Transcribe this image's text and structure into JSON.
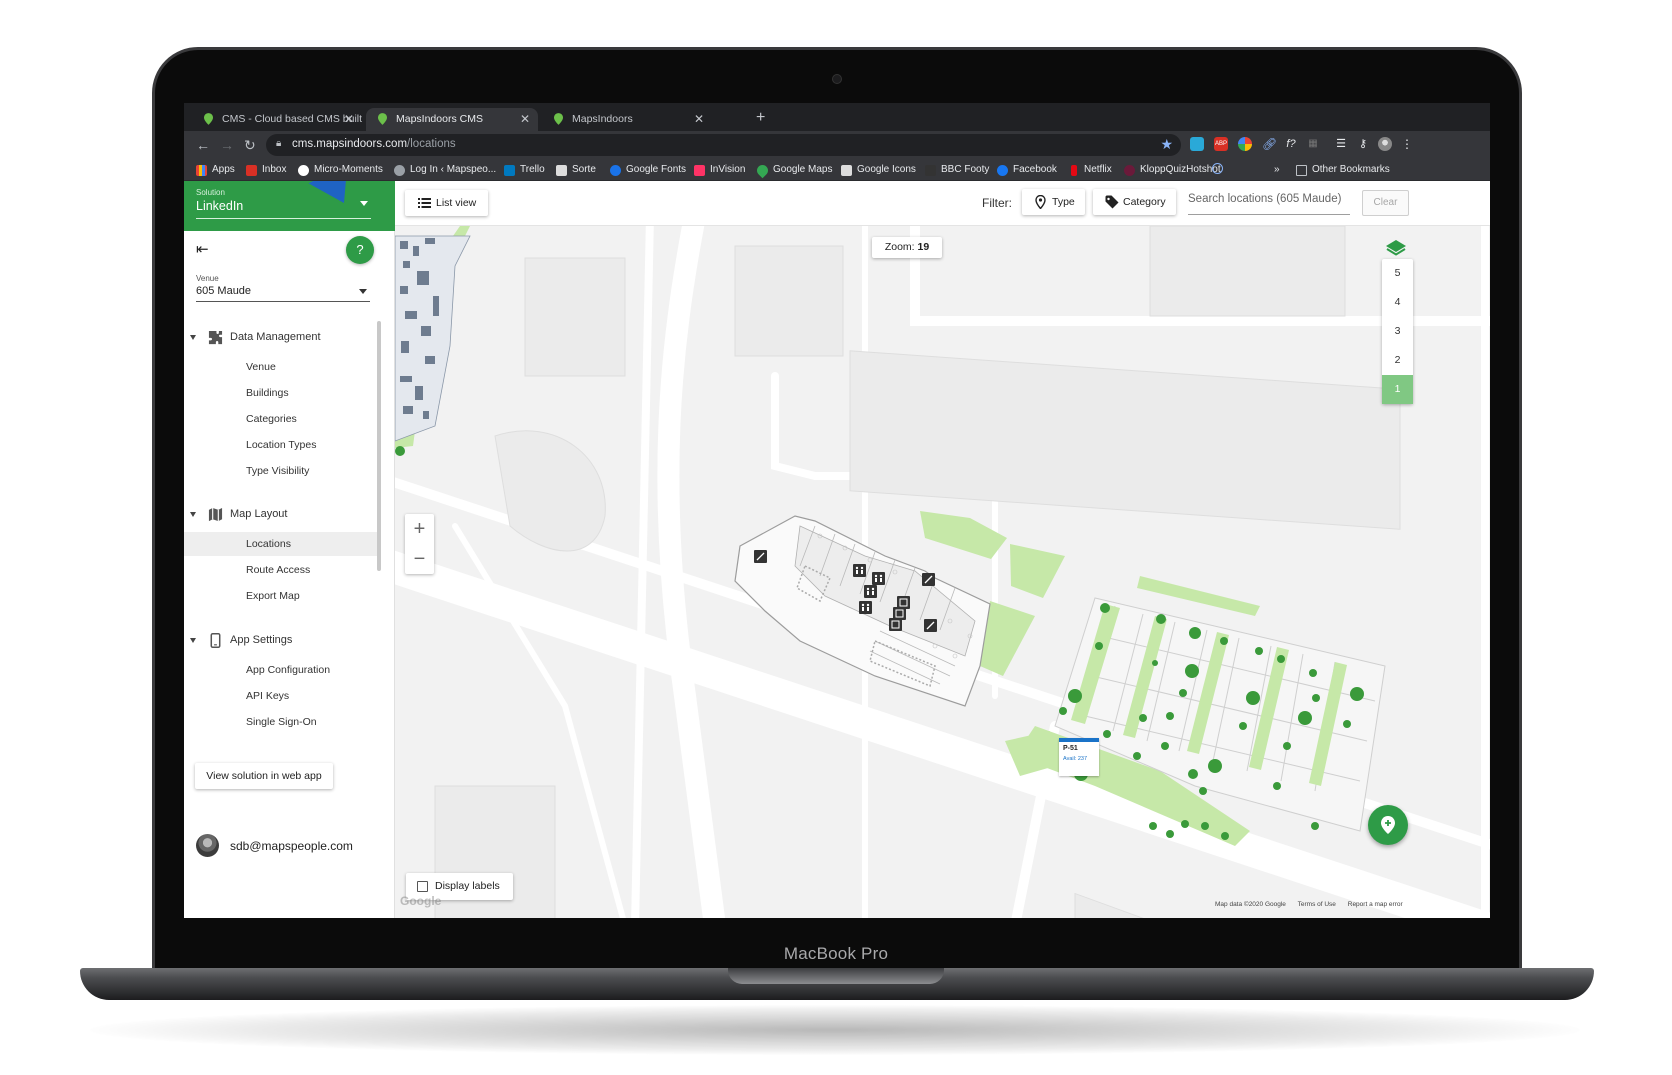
{
  "device": {
    "brand": "MacBook Pro"
  },
  "browser": {
    "tabs": [
      {
        "title": "CMS - Cloud based CMS built",
        "active": false
      },
      {
        "title": "MapsIndoors CMS",
        "active": true
      },
      {
        "title": "MapsIndoors",
        "active": false
      }
    ],
    "url_host": "cms.mapsindoors.com",
    "url_path": "/locations",
    "bookmarks": [
      "Apps",
      "Inbox",
      "Micro-Moments",
      "Log In ‹ Mapspeo...",
      "Trello",
      "Sorte",
      "Google Fonts",
      "InVision",
      "Google Maps",
      "Google Icons",
      "BBC Footy",
      "Facebook",
      "Netflix",
      "KloppQuizHotshot"
    ],
    "bookmarks_overflow": "»",
    "other_bookmarks": "Other Bookmarks"
  },
  "sidebar": {
    "solution_label": "Solution",
    "solution_value": "LinkedIn",
    "venue_label": "Venue",
    "venue_value": "605 Maude",
    "sections": [
      {
        "label": "Data Management",
        "icon": "puzzle-icon",
        "items": [
          "Venue",
          "Buildings",
          "Categories",
          "Location Types",
          "Type Visibility"
        ]
      },
      {
        "label": "Map Layout",
        "icon": "map-icon",
        "items": [
          "Locations",
          "Route Access",
          "Export Map"
        ],
        "active_item": "Locations"
      },
      {
        "label": "App Settings",
        "icon": "phone-icon",
        "items": [
          "App Configuration",
          "API Keys",
          "Single Sign-On"
        ]
      }
    ],
    "web_app_button": "View solution in web app",
    "user_email": "sdb@mapspeople.com"
  },
  "toolbar": {
    "list_view": "List view",
    "filter_label": "Filter:",
    "type_button": "Type",
    "category_button": "Category",
    "search_placeholder": "Search locations (605 Maude)",
    "clear_button": "Clear"
  },
  "map": {
    "zoom_label": "Zoom:",
    "zoom_value": "19",
    "floors": [
      "5",
      "4",
      "3",
      "2",
      "1"
    ],
    "active_floor": "1",
    "zoom_in": "+",
    "zoom_out": "−",
    "display_labels": "Display labels",
    "display_labels_checked": false,
    "parking_label": "P-51",
    "parking_avail": "Avail: 237",
    "google_logo": "Google",
    "attribution": [
      "Map data ©2020 Google",
      "Terms of Use",
      "Report a map error"
    ]
  },
  "colors": {
    "brand_green": "#2e9b47",
    "active_floor": "#80c883",
    "park_green": "#c6e8a8",
    "parking_blue": "#1a73c8"
  }
}
